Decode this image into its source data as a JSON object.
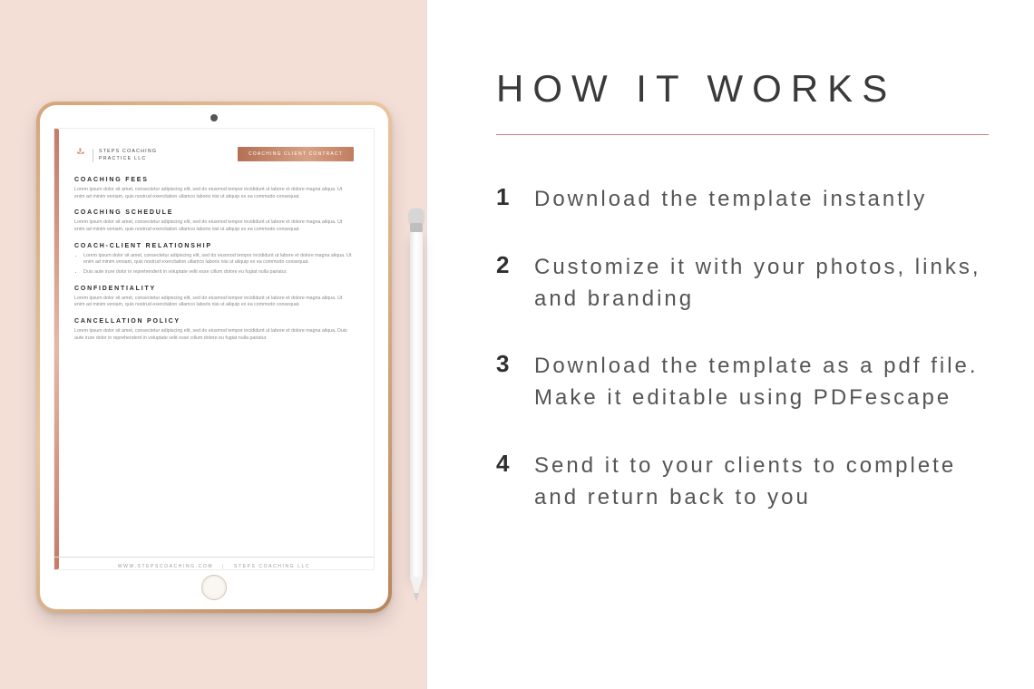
{
  "left": {
    "brand": {
      "line1": "STEPS COACHING",
      "line2": "PRACTICE LLC"
    },
    "ribbon": "COACHING CLIENT CONTRACT",
    "sections": [
      {
        "heading": "COACHING FEES",
        "body": "Lorem ipsum dolor sit amet, consectetur adipiscing elit, sed do eiusmod tempor incididunt ut labore et dolore magna aliqua. Ut enim ad minim veniam, quis nostrud exercitation ullamco laboris nisi ut aliquip ex ea commodo consequat."
      },
      {
        "heading": "COACHING SCHEDULE",
        "body": "Lorem ipsum dolor sit amet, consectetur adipiscing elit, sed do eiusmod tempor incididunt ut labore et dolore magna aliqua. Ut enim ad minim veniam, quis nostrud exercitation ullamco laboris nisi ut aliquip ex ea commodo consequat."
      },
      {
        "heading": "COACH-CLIENT RELATIONSHIP",
        "bullets": [
          "Lorem ipsum dolor sit amet, consectetur adipiscing elit, sed do eiusmod tempor incididunt ut labore et dolore magna aliqua. Ut enim ad minim veniam, quis nostrud exercitation ullamco laboris nisi ut aliquip ex ea commodo consequat.",
          "Duis aute irure dolor in reprehenderit in voluptate velit esse cillum dolore eu fugiat nulla pariatur."
        ]
      },
      {
        "heading": "CONFIDENTIALITY",
        "body": "Lorem ipsum dolor sit amet, consectetur adipiscing elit, sed do eiusmod tempor incididunt ut labore et dolore magna aliqua. Ut enim ad minim veniam, quis nostrud exercitation ullamco laboris nisi ut aliquip ex ea commodo consequat."
      },
      {
        "heading": "CANCELLATION POLICY",
        "body": "Lorem ipsum dolor sit amet, consectetur adipiscing elit, sed do eiusmod tempor incididunt ut labore et dolore magna aliqua. Duis aute irure dolor in reprehenderit in voluptate velit esse cillum dolore eu fugiat nulla pariatur."
      }
    ],
    "footer": {
      "url": "WWW.STEPSCOACHING.COM",
      "company": "STEPS COACHING LLC"
    }
  },
  "right": {
    "title": "HOW IT WORKS",
    "steps": [
      {
        "n": "1",
        "text": "Download the template instantly"
      },
      {
        "n": "2",
        "text": "Customize it with your photos, links, and branding"
      },
      {
        "n": "3",
        "text": "Download the template as a pdf file. Make it editable using PDFescape"
      },
      {
        "n": "4",
        "text": "Send it to your clients to complete and return back to you"
      }
    ]
  }
}
